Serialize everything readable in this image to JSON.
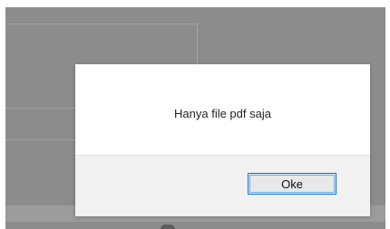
{
  "dialog": {
    "message": "Hanya file pdf saja",
    "ok_label": "Oke"
  },
  "colors": {
    "backdrop": "#8c8c8c",
    "dialog_bg": "#ffffff",
    "footer_bg": "#f1f1f1",
    "button_border": "#0e72cf"
  }
}
